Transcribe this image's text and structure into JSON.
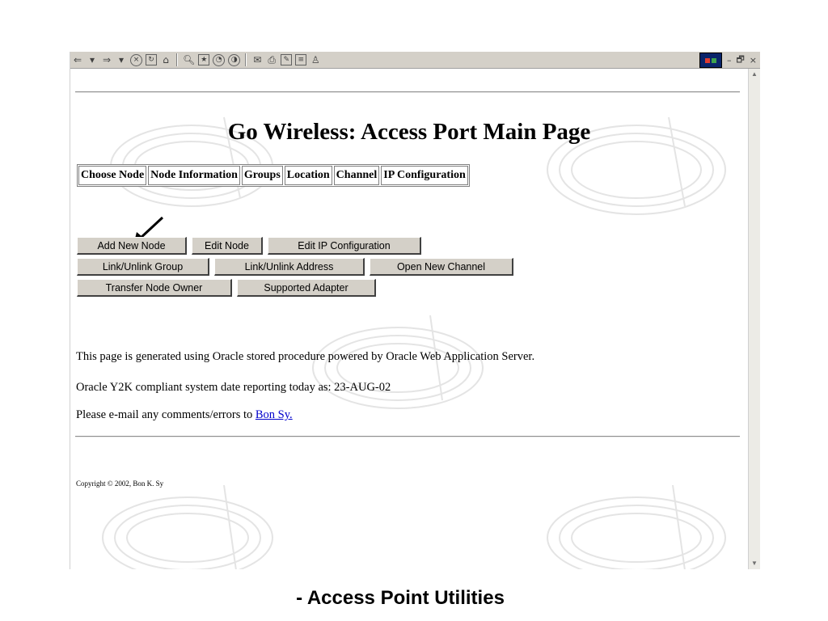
{
  "toolbar": {
    "icons": [
      "back-icon",
      "forward-icon",
      "stop-icon",
      "refresh-icon",
      "home-icon",
      "search-icon",
      "favorites-icon",
      "history-icon",
      "channels-icon",
      "mail-icon",
      "print-icon",
      "edit-icon",
      "discuss-icon",
      "messenger-icon"
    ],
    "win_controls": [
      "–",
      "🗗",
      "×"
    ]
  },
  "page": {
    "title": "Go Wireless: Access Port Main Page",
    "nav": [
      "Choose Node",
      "Node Information",
      "Groups",
      "Location",
      "Channel",
      "IP Configuration"
    ],
    "buttons_row1": [
      "Add New Node",
      "Edit Node",
      "Edit IP Configuration"
    ],
    "buttons_row2": [
      "Link/Unlink Group",
      "Link/Unlink Address",
      "Open New Channel"
    ],
    "buttons_row3": [
      "Transfer Node Owner",
      "Supported Adapter"
    ],
    "info_line1": "This page is generated using Oracle stored procedure powered by Oracle Web Application Server.",
    "info_line2": "Oracle Y2K compliant system date reporting today as: 23-AUG-02",
    "email_prefix": "Please e-mail any comments/errors to",
    "email_link": "Bon Sy.",
    "copyright": "Copyright © 2002, Bon K. Sy"
  },
  "caption": "- Access Point Utilities"
}
